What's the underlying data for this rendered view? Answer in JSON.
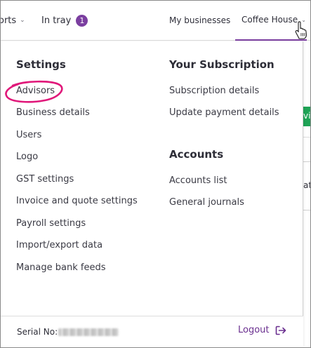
{
  "topnav": {
    "reports_label": "orts",
    "intray_label": "In tray",
    "intray_count": "1",
    "my_businesses_label": "My businesses",
    "current_business_label": "Coffee House"
  },
  "dropdown": {
    "settings": {
      "heading": "Settings",
      "items": [
        "Advisors",
        "Business details",
        "Users",
        "Logo",
        "GST settings",
        "Invoice and quote settings",
        "Payroll settings",
        "Import/export data",
        "Manage bank feeds"
      ]
    },
    "subscription": {
      "heading": "Your Subscription",
      "items": [
        "Subscription details",
        "Update payment details"
      ]
    },
    "accounts": {
      "heading": "Accounts",
      "items": [
        "Accounts list",
        "General journals"
      ]
    }
  },
  "footer": {
    "serial_label": "Serial No:",
    "logout_label": "Logout"
  },
  "background": {
    "green_button_fragment": "vis",
    "field_fragment": "ati"
  },
  "colors": {
    "accent": "#7b3fa0",
    "highlight_ring": "#e0187a",
    "green_button": "#1fa356"
  }
}
